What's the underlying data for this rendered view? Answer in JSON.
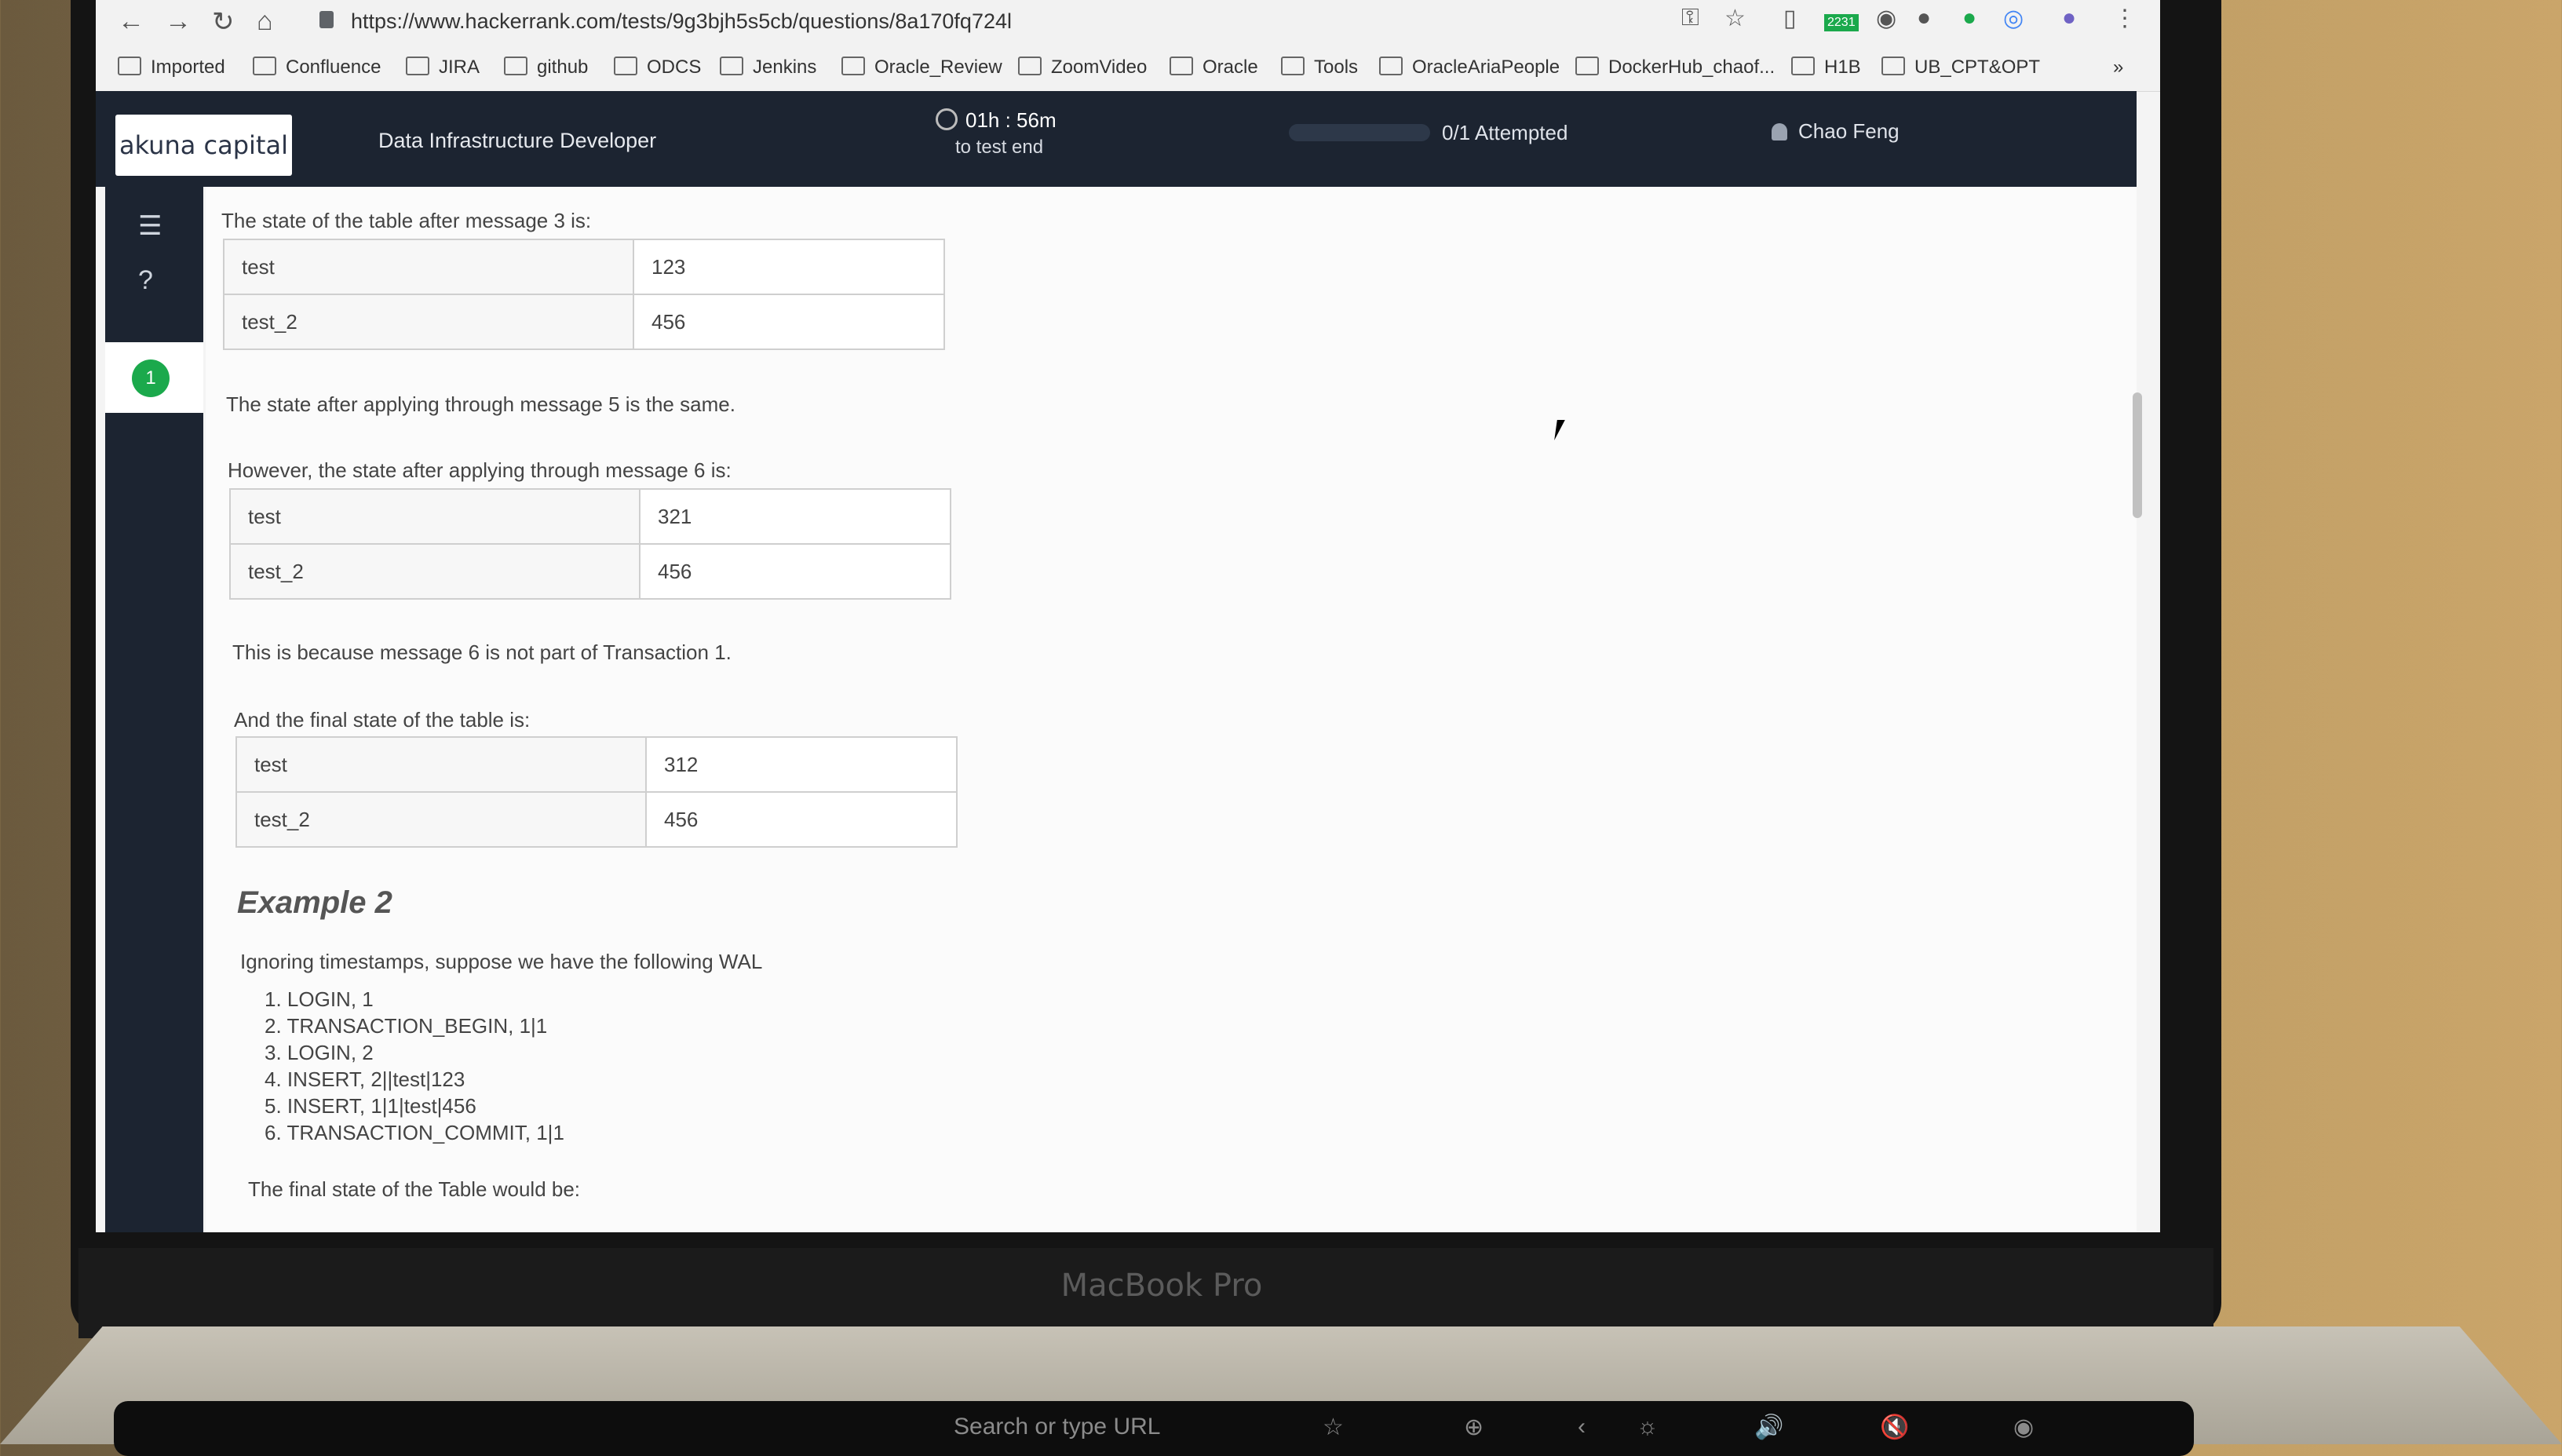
{
  "browser": {
    "url": "https://www.hackerrank.com/tests/9g3bjh5s5cb/questions/8a170fq724l",
    "extension_badge": "2231",
    "bookmarks": [
      "Imported",
      "Confluence",
      "JIRA",
      "github",
      "ODCS",
      "Jenkins",
      "Oracle_Review",
      "ZoomVideo",
      "Oracle",
      "Tools",
      "OracleAriaPeople",
      "DockerHub_chaof...",
      "H1B",
      "UB_CPT&OPT"
    ]
  },
  "header": {
    "logo": "akuna capital",
    "title": "Data Infrastructure Developer",
    "timer": "01h : 56m",
    "timer_sub": "to test end",
    "attempted": "0/1 Attempted",
    "user": "Chao Feng"
  },
  "sidebar": {
    "question_number": "1"
  },
  "content": {
    "p1": "The state of the table after message 3 is:",
    "table1": [
      [
        "test",
        "123"
      ],
      [
        "test_2",
        "456"
      ]
    ],
    "p2": "The state after applying through message 5 is the same.",
    "p3": "However, the state after applying through message 6 is:",
    "table2": [
      [
        "test",
        "321"
      ],
      [
        "test_2",
        "456"
      ]
    ],
    "p4": "This is because message 6 is not part of Transaction 1.",
    "p5": "And the final state of the table is:",
    "table3": [
      [
        "test",
        "312"
      ],
      [
        "test_2",
        "456"
      ]
    ],
    "example_heading": "Example 2",
    "p6": "Ignoring timestamps, suppose we have the following WAL",
    "wal": [
      "1. LOGIN, 1",
      "2. TRANSACTION_BEGIN, 1|1",
      "3. LOGIN, 2",
      "4. INSERT, 2||test|123",
      "5. INSERT, 1|1|test|456",
      "6. TRANSACTION_COMMIT, 1|1"
    ],
    "p7": "The final state of the Table would be:"
  },
  "laptop": {
    "brand": "MacBook Pro",
    "touchbar_search": "Search or type URL"
  }
}
